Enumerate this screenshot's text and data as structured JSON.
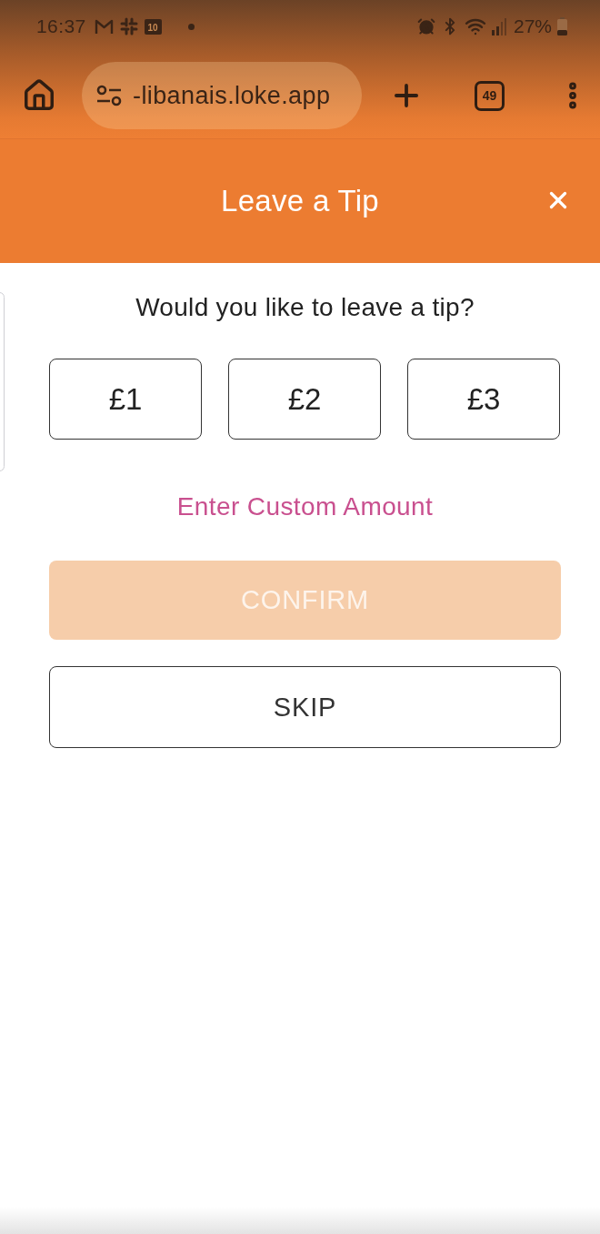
{
  "status_bar": {
    "time": "16:37",
    "calendar_date": "10",
    "battery": "27%"
  },
  "browser_toolbar": {
    "url": "-libanais.loke.app",
    "tab_count": "49"
  },
  "header": {
    "title": "Leave a Tip"
  },
  "tip_prompt": "Would you like to leave a tip?",
  "tip_options": [
    {
      "label": "£1",
      "selected": false
    },
    {
      "label": "£2",
      "selected": false
    },
    {
      "label": "£3",
      "selected": false
    }
  ],
  "custom_amount_link": "Enter Custom Amount",
  "buttons": [
    {
      "kind": "primary",
      "label": "CONFIRM",
      "disabled": true
    },
    {
      "kind": "outline",
      "label": "SKIP",
      "disabled": false
    }
  ]
}
